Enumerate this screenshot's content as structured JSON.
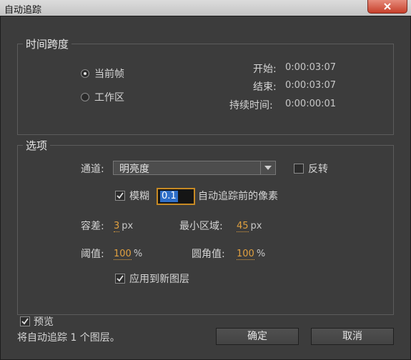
{
  "window": {
    "title": "自动追踪"
  },
  "timespan": {
    "legend": "时间跨度",
    "options": [
      {
        "label": "当前帧",
        "selected": true
      },
      {
        "label": "工作区",
        "selected": false
      }
    ],
    "start_label": "开始:",
    "start_value": "0:00:03:07",
    "end_label": "结束:",
    "end_value": "0:00:03:07",
    "duration_label": "持续时间:",
    "duration_value": "0:00:00:01"
  },
  "options": {
    "legend": "选项",
    "channel_label": "通道:",
    "channel_value": "明亮度",
    "invert_label": "反转",
    "invert_checked": false,
    "blur_label": "模糊",
    "blur_checked": true,
    "blur_value": "0.1",
    "blur_suffix": "自动追踪前的像素",
    "tolerance_label": "容差:",
    "tolerance_value": "3",
    "tolerance_unit": "px",
    "min_area_label": "最小区域:",
    "min_area_value": "45",
    "min_area_unit": "px",
    "threshold_label": "阈值:",
    "threshold_value": "100",
    "threshold_unit": "%",
    "corner_label": "圆角值:",
    "corner_value": "100",
    "corner_unit": "%",
    "apply_new_layer_label": "应用到新图层",
    "apply_new_layer_checked": true
  },
  "footer": {
    "preview_label": "预览",
    "preview_checked": true,
    "summary": "将自动追踪 1 个图层。",
    "ok_label": "确定",
    "cancel_label": "取消"
  },
  "colors": {
    "accent_focus": "#c78a24",
    "value_orange": "#e0a040",
    "selection_blue": "#2e6ec8",
    "close_red": "#c7402b"
  }
}
